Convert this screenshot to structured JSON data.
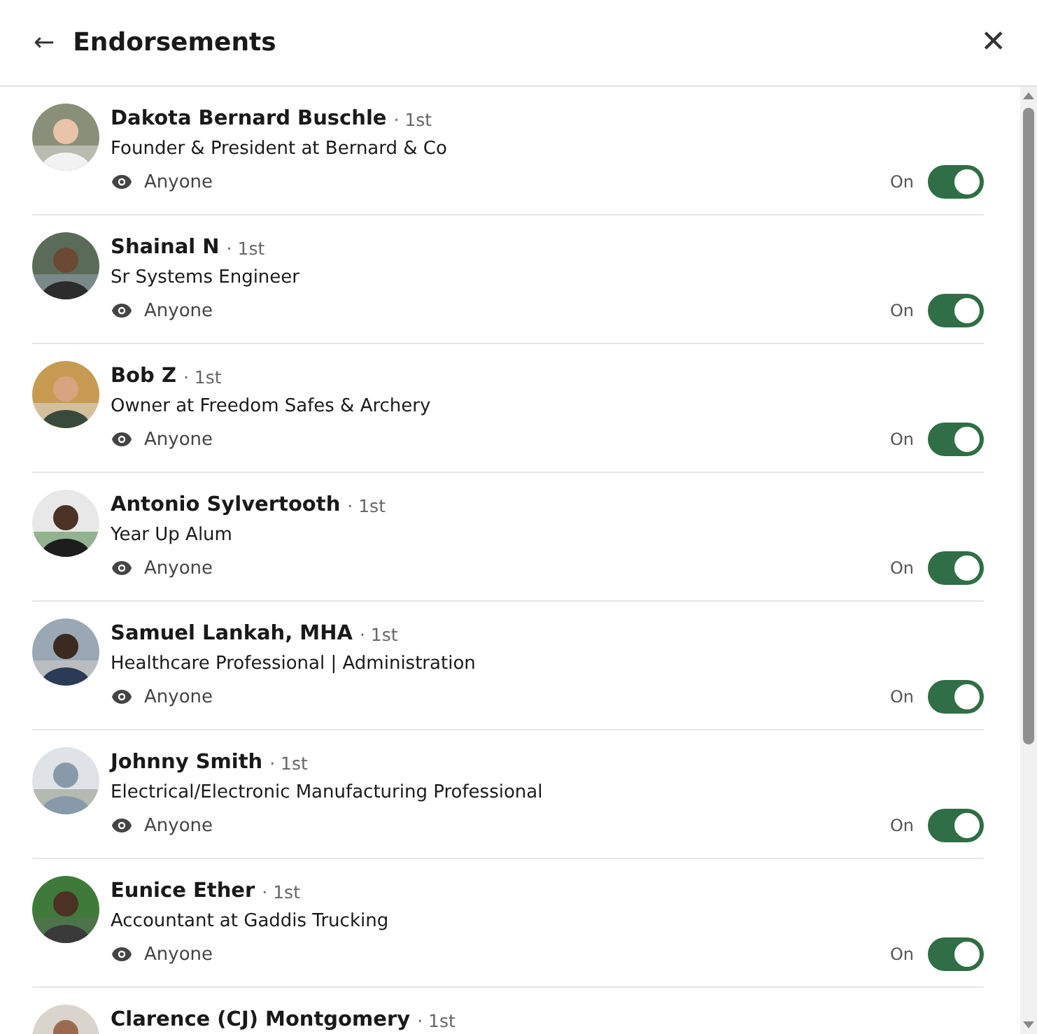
{
  "header": {
    "back_icon": "←",
    "title": "Endorsements",
    "close_icon": "✕"
  },
  "people": [
    {
      "name": "Dakota Bernard Buschle",
      "degree": "· 1st",
      "headline": "Founder & President at Bernard & Co",
      "visibility": "Anyone",
      "on": true,
      "state_label": "On"
    },
    {
      "name": "Shainal N",
      "degree": "· 1st",
      "headline": "Sr Systems Engineer",
      "visibility": "Anyone",
      "on": true,
      "state_label": "On"
    },
    {
      "name": "Bob Z",
      "degree": "· 1st",
      "headline": "Owner at Freedom Safes & Archery",
      "visibility": "Anyone",
      "on": true,
      "state_label": "On"
    },
    {
      "name": "Antonio Sylvertooth",
      "degree": "· 1st",
      "headline": "Year Up Alum",
      "visibility": "Anyone",
      "on": true,
      "state_label": "On"
    },
    {
      "name": "Samuel Lankah, MHA",
      "degree": "· 1st",
      "headline": "Healthcare Professional | Administration",
      "visibility": "Anyone",
      "on": true,
      "state_label": "On"
    },
    {
      "name": "Johnny Smith",
      "degree": "· 1st",
      "headline": "Electrical/Electronic Manufacturing Professional",
      "visibility": "Anyone",
      "on": true,
      "state_label": "On"
    },
    {
      "name": "Eunice Ether",
      "degree": "· 1st",
      "headline": "Accountant at Gaddis Trucking",
      "visibility": "Anyone",
      "on": true,
      "state_label": "On"
    },
    {
      "name": "Clarence (CJ) Montgomery",
      "degree": "· 1st"
    }
  ]
}
